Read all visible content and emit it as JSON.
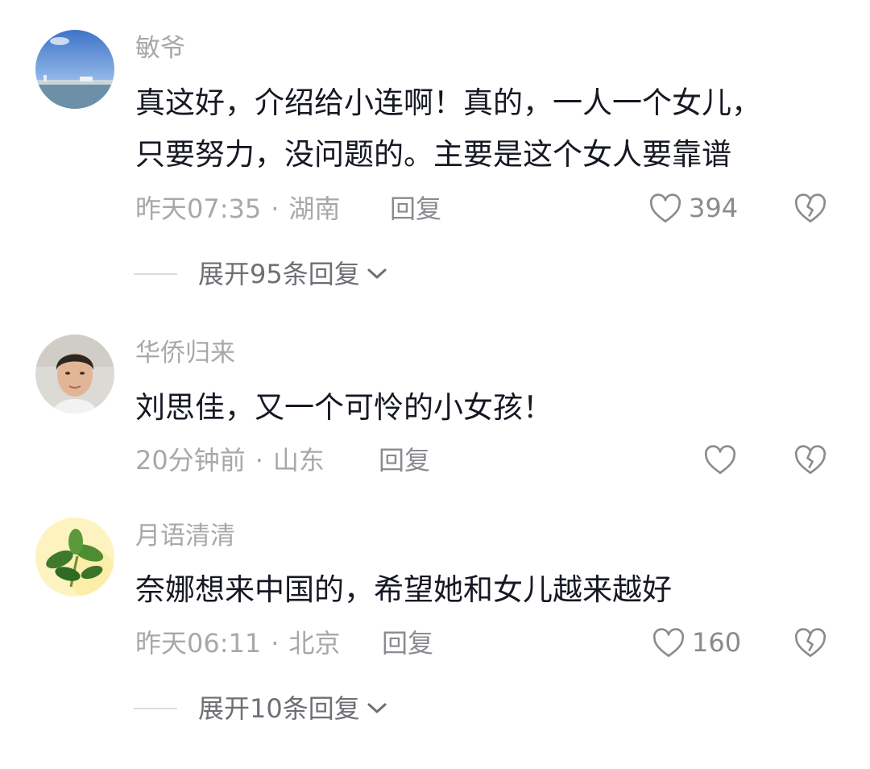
{
  "comments": [
    {
      "avatar_icon": "sky-landscape-avatar",
      "username": "敏爷",
      "content_lines": [
        "真这好，介绍给小连啊！真的，一人一个女儿，",
        "只要努力，没问题的。主要是这个女人要靠谱"
      ],
      "time": "昨天07:35",
      "location": "湖南",
      "reply_label": "回复",
      "likes": "394",
      "expand_label": "展开95条回复"
    },
    {
      "avatar_icon": "man-portrait-avatar",
      "username": "华侨归来",
      "content_lines": [
        "刘思佳，又一个可怜的小女孩！"
      ],
      "time": "20分钟前",
      "location": "山东",
      "reply_label": "回复",
      "likes": ""
    },
    {
      "avatar_icon": "plant-avatar",
      "username": "月语清清",
      "content_lines": [
        "奈娜想来中国的，希望她和女儿越来越好"
      ],
      "time": "昨天06:11",
      "location": "北京",
      "reply_label": "回复",
      "likes": "160",
      "expand_label": "展开10条回复"
    }
  ],
  "separator": "·",
  "icons": {
    "like": "heart-outline-icon",
    "dislike": "broken-heart-icon",
    "expand": "chevron-down-icon"
  },
  "colors": {
    "text": "#161823",
    "secondary": "#a8a8ac",
    "icon": "#8a8a90"
  }
}
